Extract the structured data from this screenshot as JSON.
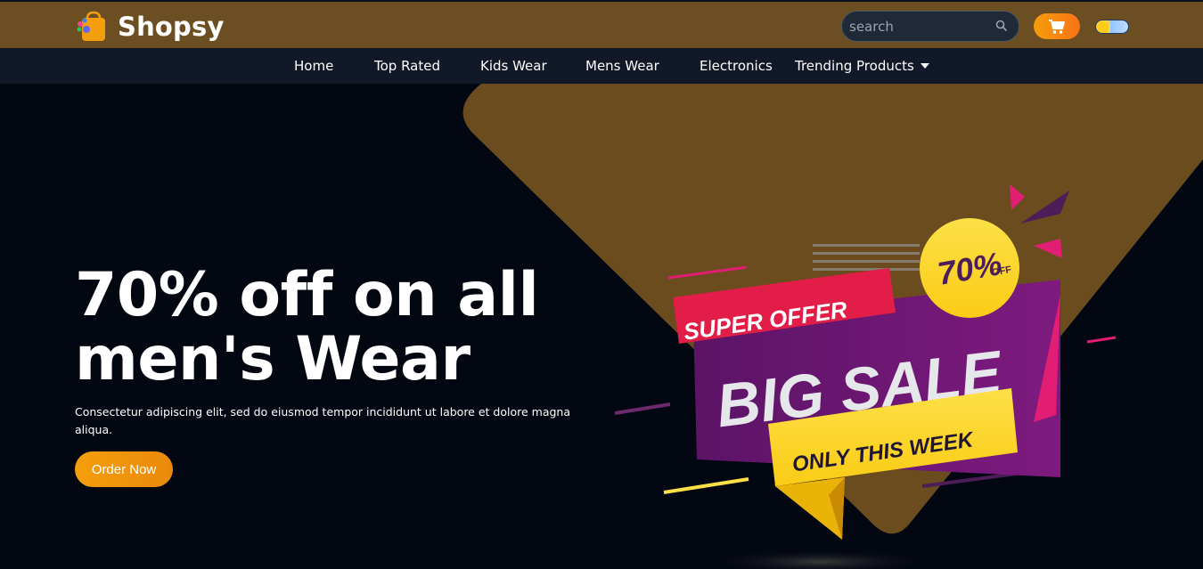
{
  "header": {
    "brand": "Shopsy",
    "search": {
      "placeholder": "search",
      "value": ""
    },
    "icons": [
      "shopping-bag-icon",
      "search-icon",
      "cart-icon",
      "theme-toggle"
    ],
    "colors": {
      "topbar": "#6b4f22",
      "navbar": "#111827",
      "accent": "#f59e0b"
    }
  },
  "nav": {
    "items": [
      {
        "label": "Home"
      },
      {
        "label": "Top Rated"
      },
      {
        "label": "Kids Wear"
      },
      {
        "label": "Mens Wear"
      },
      {
        "label": "Electronics"
      },
      {
        "label": "Trending Products",
        "has_dropdown": true
      }
    ]
  },
  "hero": {
    "headline": "70% off on all men's Wear",
    "subtext": "Consectetur adipiscing elit, sed do eiusmod tempor incididunt ut labore et dolore magna aliqua.",
    "cta": "Order Now",
    "banner": {
      "tag": "SUPER OFFER",
      "badge_percent": "70%",
      "badge_off": "OFF",
      "main": "BIG SALE",
      "ribbon": "ONLY THIS WEEK"
    }
  }
}
